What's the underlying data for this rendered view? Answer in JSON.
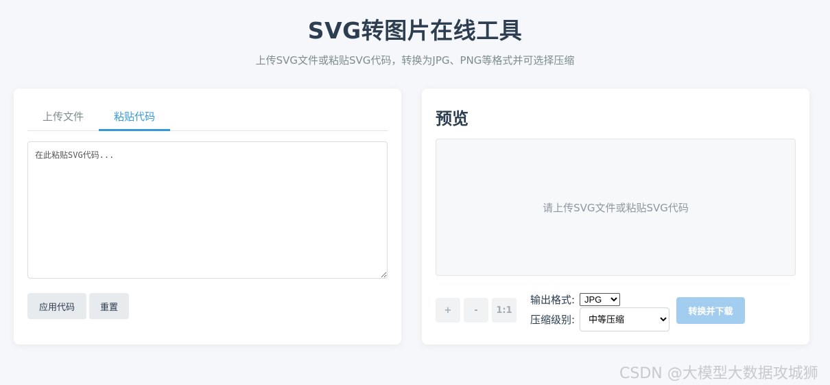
{
  "header": {
    "title": "SVG转图片在线工具",
    "subtitle": "上传SVG文件或粘贴SVG代码，转换为JPG、PNG等格式并可选择压缩"
  },
  "editor": {
    "tabs": [
      {
        "label": "上传文件",
        "active": false
      },
      {
        "label": "粘贴代码",
        "active": true
      }
    ],
    "code_placeholder": "在此粘贴SVG代码...",
    "code_value": "",
    "apply_label": "应用代码",
    "reset_label": "重置"
  },
  "preview": {
    "title": "预览",
    "placeholder": "请上传SVG文件或粘贴SVG代码",
    "zoom_in_label": "+",
    "zoom_out_label": "-",
    "zoom_reset_label": "1:1",
    "format_label": "输出格式:",
    "format_selected": "JPG",
    "compress_label": "压缩级别:",
    "compress_selected": "中等压缩",
    "convert_label": "转换并下载"
  },
  "watermark": "CSDN @大模型大数据攻城狮",
  "colors": {
    "accent": "#3498db",
    "convert_disabled": "#a3cdee",
    "background": "#f5f7fa"
  }
}
